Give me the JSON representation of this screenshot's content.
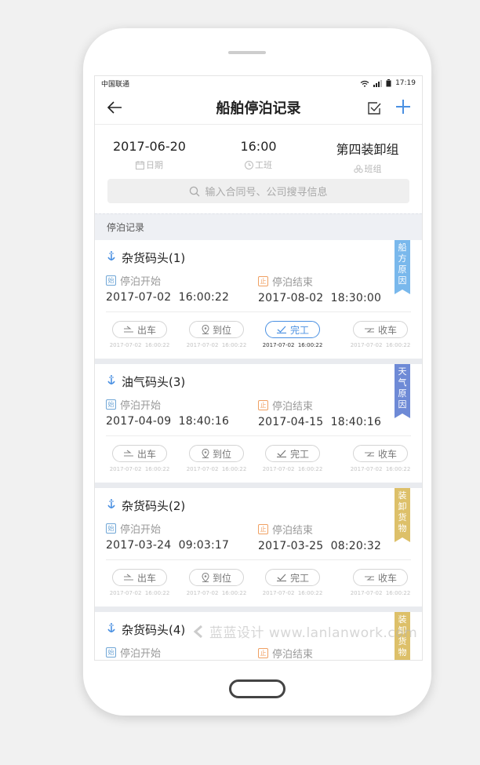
{
  "status": {
    "carrier": "中国联通",
    "time": "17:19"
  },
  "nav": {
    "title": "船舶停泊记录",
    "back_icon": "arrow-left-icon",
    "confirm_icon": "checkbox-icon",
    "add_icon": "plus-icon"
  },
  "info": {
    "date": {
      "value": "2017-06-20",
      "label": "日期"
    },
    "shift": {
      "value": "16:00",
      "label": "工班"
    },
    "team": {
      "value": "第四装卸组",
      "label": "班组"
    }
  },
  "search": {
    "placeholder": "输入合同号、公司搜寻信息"
  },
  "section": {
    "title": "停泊记录"
  },
  "labels": {
    "start": "停泊开始",
    "end": "停泊结束",
    "start_badge": "始",
    "end_badge": "止"
  },
  "colors": {
    "accent": "#4a90e2",
    "ribbon_ship": "#79b8ec",
    "ribbon_weather": "#6e8ad6",
    "ribbon_cargo": "#ddc069"
  },
  "records": [
    {
      "title": "杂货码头(1)",
      "start": "2017-07-02  16:00:22",
      "end": "2017-08-02  18:30:00",
      "ribbon": "船方原因",
      "steps": [
        {
          "label": "出车",
          "time": "2017-07-02  16:00:22"
        },
        {
          "label": "到位",
          "time": "2017-07-02  16:00:22"
        },
        {
          "label": "完工",
          "time": "2017-07-02  16:00:22"
        },
        {
          "label": "收车",
          "time": "2017-07-02  16:00:22"
        }
      ]
    },
    {
      "title": "油气码头(3)",
      "start": "2017-04-09  18:40:16",
      "end": "2017-04-15  18:40:16",
      "ribbon": "天气原因",
      "steps": [
        {
          "label": "出车",
          "time": "2017-07-02  16:00:22"
        },
        {
          "label": "到位",
          "time": "2017-07-02  16:00:22"
        },
        {
          "label": "完工",
          "time": "2017-07-02  16:00:22"
        },
        {
          "label": "收车",
          "time": "2017-07-02  16:00:22"
        }
      ]
    },
    {
      "title": "杂货码头(2)",
      "start": "2017-03-24  09:03:17",
      "end": "2017-03-25  08:20:32",
      "ribbon": "装卸货物",
      "steps": [
        {
          "label": "出车",
          "time": "2017-07-02  16:00:22"
        },
        {
          "label": "到位",
          "time": "2017-07-02  16:00:22"
        },
        {
          "label": "完工",
          "time": "2017-07-02  16:00:22"
        },
        {
          "label": "收车",
          "time": "2017-07-02  16:00:22"
        }
      ]
    },
    {
      "title": "杂货码头(4)",
      "ribbon": "装卸货物"
    }
  ],
  "watermark": "蓝蓝设计 www.lanlanwork.com"
}
